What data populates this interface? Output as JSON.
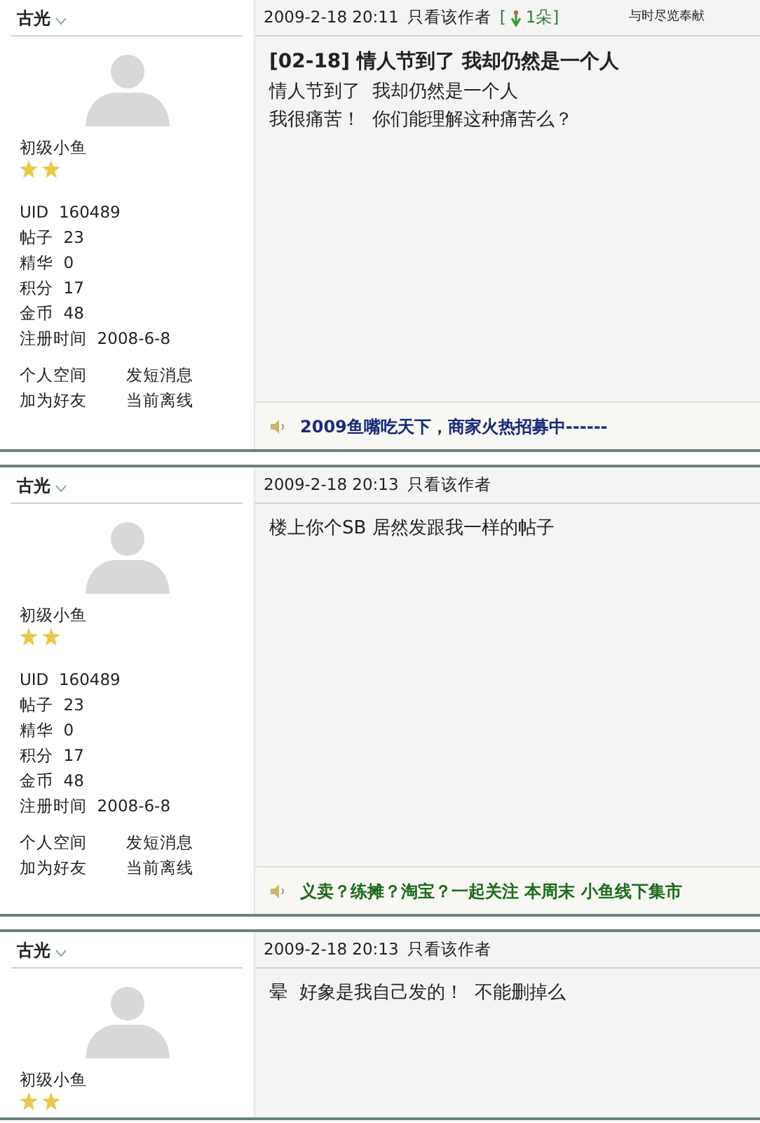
{
  "posts": [
    {
      "author": "古光",
      "rank": "初级小鱼",
      "rank_icons": [
        {
          "kind": "star"
        },
        {
          "kind": "star"
        }
      ],
      "stats": [
        {
          "label": "UID",
          "value": "160489"
        },
        {
          "label": "帖子",
          "value": "23"
        },
        {
          "label": "精华",
          "value": "0"
        },
        {
          "label": "积分",
          "value": "17"
        },
        {
          "label": "金币",
          "value": "48"
        },
        {
          "label": "注册时间",
          "value": "2008-6-8"
        }
      ],
      "links": [
        "个人空间",
        "发短消息",
        "加为好友",
        "当前离线"
      ],
      "date": "2009-2-18 20:11",
      "author_only": "只看该作者",
      "flower": {
        "before": "[",
        "after": "1朵]"
      },
      "note": "与时尽览奉献",
      "title": "[02-18] 情人节到了  我却仍然是一个人",
      "body": [
        "情人节到了  我却仍然是一个人",
        "我很痛苦！  你们能理解这种痛苦么？"
      ],
      "signature": {
        "text": "2009鱼嘴吃天下，商家火热招募中------",
        "color": "#1a2a7a"
      }
    },
    {
      "author": "古光",
      "rank": "初级小鱼",
      "rank_icons": [
        {
          "kind": "star"
        },
        {
          "kind": "star"
        }
      ],
      "stats": [
        {
          "label": "UID",
          "value": "160489"
        },
        {
          "label": "帖子",
          "value": "23"
        },
        {
          "label": "精华",
          "value": "0"
        },
        {
          "label": "积分",
          "value": "17"
        },
        {
          "label": "金币",
          "value": "48"
        },
        {
          "label": "注册时间",
          "value": "2008-6-8"
        }
      ],
      "links": [
        "个人空间",
        "发短消息",
        "加为好友",
        "当前离线"
      ],
      "date": "2009-2-18 20:13",
      "author_only": "只看该作者",
      "body": [
        "楼上你个SB 居然发跟我一样的帖子"
      ],
      "signature": {
        "text": "义卖？练摊？淘宝？一起关注  本周末  小鱼线下集市",
        "color": "#1e6b1e"
      }
    },
    {
      "author": "古光",
      "rank": "初级小鱼",
      "rank_icons": [
        {
          "kind": "star"
        },
        {
          "kind": "star"
        }
      ],
      "date": "2009-2-18 20:13",
      "author_only": "只看该作者",
      "body": [
        "晕  好象是我自己发的！  不能删掉么"
      ]
    }
  ]
}
